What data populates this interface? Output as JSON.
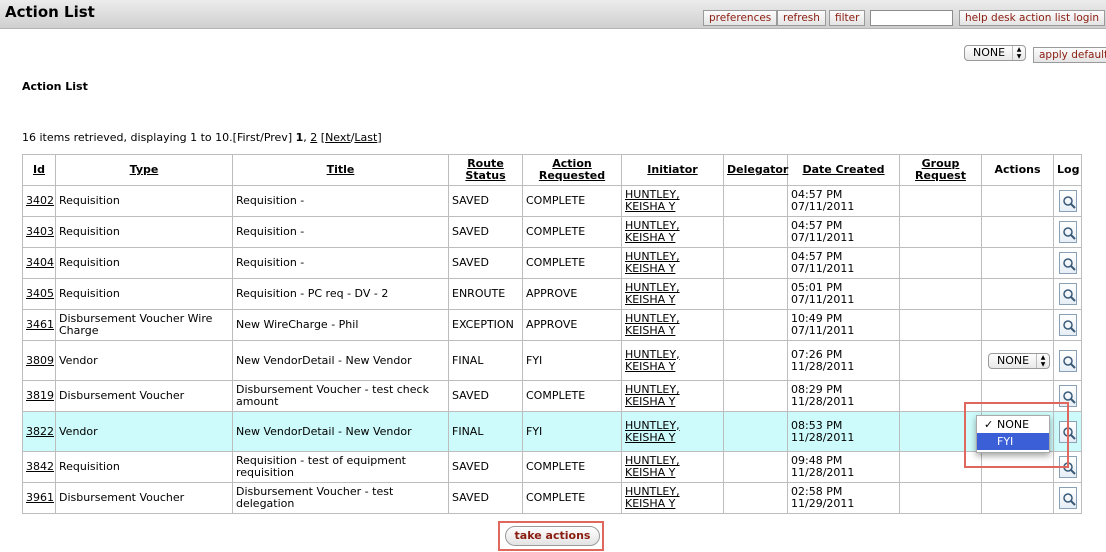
{
  "app": {
    "title": "Action List"
  },
  "toolbar": {
    "preferences": "preferences",
    "refresh": "refresh",
    "filter": "filter",
    "search_value": "",
    "help_desk": "help desk action list login"
  },
  "default_action": {
    "selected": "NONE",
    "apply": "apply default"
  },
  "heading": "Action List",
  "pager": {
    "summary": "16 items retrieved, displaying 1 to 10.",
    "open_bracket": "[",
    "first": "First",
    "prev": "Prev",
    "close_bracket": "]",
    "current_page": "1",
    "sep": ",",
    "page2": "2",
    "next": "Next",
    "last": "Last"
  },
  "table": {
    "headers": {
      "id": "Id",
      "type": "Type",
      "title": "Title",
      "route_status_1": "Route",
      "route_status_2": "Status",
      "action_requested_1": "Action",
      "action_requested_2": "Requested",
      "initiator": "Initiator",
      "delegator": "Delegator",
      "date_created": "Date Created",
      "group_request_1": "Group",
      "group_request_2": "Request",
      "actions": "Actions",
      "log": "Log"
    },
    "rows": [
      {
        "id": "3402",
        "type": "Requisition",
        "title": "Requisition -",
        "status": "SAVED",
        "action": "COMPLETE",
        "initiator_1": "HUNTLEY,",
        "initiator_2": "KEISHA Y",
        "time": "04:57 PM",
        "date": "07/11/2011",
        "select": ""
      },
      {
        "id": "3403",
        "type": "Requisition",
        "title": "Requisition -",
        "status": "SAVED",
        "action": "COMPLETE",
        "initiator_1": "HUNTLEY,",
        "initiator_2": "KEISHA Y",
        "time": "04:57 PM",
        "date": "07/11/2011",
        "select": ""
      },
      {
        "id": "3404",
        "type": "Requisition",
        "title": "Requisition -",
        "status": "SAVED",
        "action": "COMPLETE",
        "initiator_1": "HUNTLEY,",
        "initiator_2": "KEISHA Y",
        "time": "04:57 PM",
        "date": "07/11/2011",
        "select": ""
      },
      {
        "id": "3405",
        "type": "Requisition",
        "title": "Requisition - PC req - DV - 2",
        "status": "ENROUTE",
        "action": "APPROVE",
        "initiator_1": "HUNTLEY,",
        "initiator_2": "KEISHA Y",
        "time": "05:01 PM",
        "date": "07/11/2011",
        "select": ""
      },
      {
        "id": "3461",
        "type": "Disbursement Voucher Wire Charge",
        "title": "New WireCharge - Phil",
        "status": "EXCEPTION",
        "action": "APPROVE",
        "initiator_1": "HUNTLEY,",
        "initiator_2": "KEISHA Y",
        "time": "10:49 PM",
        "date": "07/11/2011",
        "select": ""
      },
      {
        "id": "3809",
        "type": "Vendor",
        "title": "New VendorDetail - New Vendor",
        "status": "FINAL",
        "action": "FYI",
        "initiator_1": "HUNTLEY,",
        "initiator_2": "KEISHA Y",
        "time": "07:26 PM",
        "date": "11/28/2011",
        "select": "NONE"
      },
      {
        "id": "3819",
        "type": "Disbursement Voucher",
        "title": "Disbursement Voucher - test check amount",
        "status": "SAVED",
        "action": "COMPLETE",
        "initiator_1": "HUNTLEY,",
        "initiator_2": "KEISHA Y",
        "time": "08:29 PM",
        "date": "11/28/2011",
        "select": ""
      },
      {
        "id": "3822",
        "type": "Vendor",
        "title": "New VendorDetail - New Vendor",
        "status": "FINAL",
        "action": "FYI",
        "initiator_1": "HUNTLEY,",
        "initiator_2": "KEISHA Y",
        "time": "08:53 PM",
        "date": "11/28/2011",
        "select": ""
      },
      {
        "id": "3842",
        "type": "Requisition",
        "title": "Requisition - test of equipment requisition",
        "status": "SAVED",
        "action": "COMPLETE",
        "initiator_1": "HUNTLEY,",
        "initiator_2": "KEISHA Y",
        "time": "09:48 PM",
        "date": "11/28/2011",
        "select": ""
      },
      {
        "id": "3961",
        "type": "Disbursement Voucher",
        "title": "Disbursement Voucher - test delegation",
        "status": "SAVED",
        "action": "COMPLETE",
        "initiator_1": "HUNTLEY,",
        "initiator_2": "KEISHA Y",
        "time": "02:58 PM",
        "date": "11/29/2011",
        "select": ""
      }
    ]
  },
  "dropdown_popup": {
    "check": "✓",
    "options": [
      "NONE",
      "FYI"
    ],
    "highlighted": "FYI"
  },
  "take_actions": "take actions",
  "colors": {
    "highlight_row": "#cdfafa",
    "button_text": "#8a1c10",
    "popup_selected": "#3b5fd6",
    "annotation_box": "#e0675e"
  }
}
